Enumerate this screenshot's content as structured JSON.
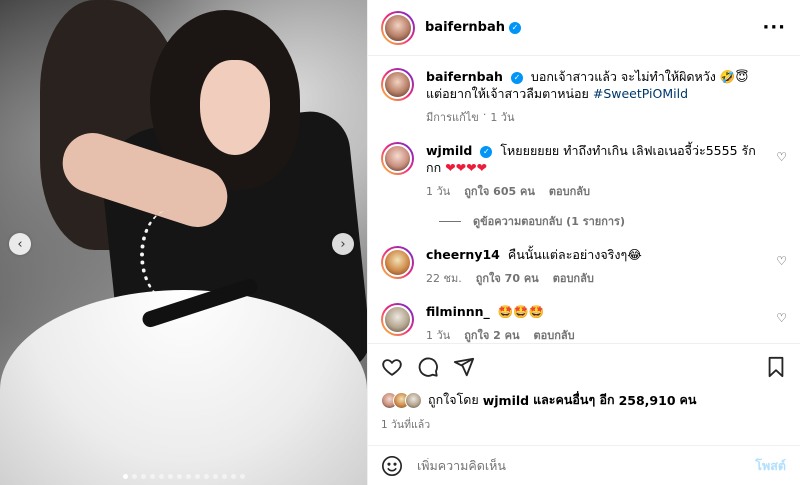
{
  "post": {
    "username": "baifernbah",
    "more_icon": "more-horizontal-icon"
  },
  "caption": {
    "username": "baifernbah",
    "text": "บอกเจ้าสาวแล้ว จะไม่ทำให้ผิดหวัง 🤣😇 แต่อยากให้เจ้าสาวลืมตาหน่อย",
    "hashtag": "#SweetPiOMild",
    "edited": "มีการแก้ไข",
    "separator": "·",
    "time": "1 วัน"
  },
  "comments": [
    {
      "username": "wjmild",
      "verified": true,
      "text": "โหยยยยยย ทำถึงทำเกิน เลิฟเอเนอจี้ว่ะ5555 รักกก",
      "hearts": "❤❤❤❤",
      "time": "1 วัน",
      "likes": "ถูกใจ 605 คน",
      "reply": "ตอบกลับ",
      "view_replies": "ดูข้อความตอบกลับ (1 รายการ)"
    },
    {
      "username": "cheerny14",
      "verified": false,
      "text": "คืนนั้นแต่ละอย่างจริงๆ😂",
      "time": "22 ชม.",
      "likes": "ถูกใจ 70 คน",
      "reply": "ตอบกลับ"
    },
    {
      "username": "filminnn_",
      "verified": false,
      "text": "🤩🤩🤩",
      "time": "1 วัน",
      "likes": "ถูกใจ 2 คน",
      "reply": "ตอบกลับ"
    }
  ],
  "actions": {
    "icons": [
      "heart-icon",
      "comment-icon",
      "share-icon",
      "bookmark-icon"
    ]
  },
  "likes": {
    "prefix": "ถูกใจโดย",
    "user": "wjmild",
    "middle": "และคนอื่นๆ อีก",
    "count": "258,910",
    "suffix": "คน",
    "time_ago": "1 วันที่แล้ว"
  },
  "add_comment": {
    "placeholder": "เพิ่มความคิดเห็น",
    "post_label": "โพสต์"
  },
  "carousel": {
    "total_slides": 14,
    "active_slide": 1,
    "prev_symbol": "‹",
    "next_symbol": "›"
  },
  "colors": {
    "verified": "#0095f6",
    "hashtag": "#00376b",
    "heart_red": "#ed1c3a",
    "post_disabled": "#b2dffc"
  }
}
